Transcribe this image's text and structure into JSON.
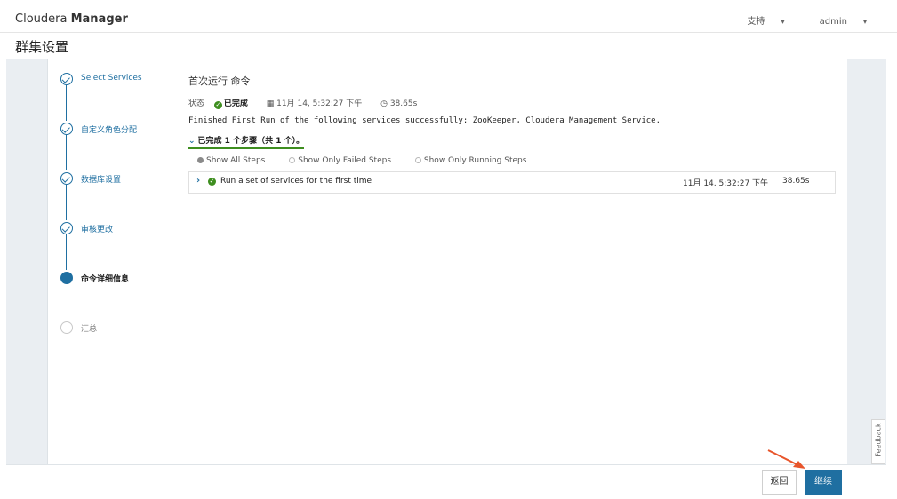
{
  "brand": {
    "prefix": "Cloudera",
    "suffix": "Manager"
  },
  "topnav": {
    "support": "支持",
    "user": "admin"
  },
  "page_title": "群集设置",
  "steps": [
    {
      "label": "Select Services",
      "state": "done"
    },
    {
      "label": "自定义角色分配",
      "state": "done"
    },
    {
      "label": "数据库设置",
      "state": "done"
    },
    {
      "label": "审核更改",
      "state": "done"
    },
    {
      "label": "命令详细信息",
      "state": "active"
    },
    {
      "label": "汇总",
      "state": "todo"
    }
  ],
  "command": {
    "title": "首次运行 命令",
    "status_label": "状态",
    "status_value": "已完成",
    "start_time": "11月 14, 5:32:27 下午",
    "duration": "38.65s",
    "message": "Finished First Run of the following services successfully: ZooKeeper, Cloudera Management Service.",
    "summary": "已完成 1 个步骤（共 1 个）。",
    "filters": [
      "Show All Steps",
      "Show Only Failed Steps",
      "Show Only Running Steps"
    ],
    "selected_filter": "Show All Steps",
    "steps": [
      {
        "name": "Run a set of services for the first time",
        "time": "11月 14, 5:32:27 下午",
        "duration": "38.65s",
        "status": "success"
      }
    ]
  },
  "feedback_label": "Feedback",
  "buttons": {
    "back": "返回",
    "continue": "继续"
  },
  "colors": {
    "accent": "#1f6fa1",
    "success": "#3e8e1f",
    "annotation_arrow": "#e8552b"
  }
}
